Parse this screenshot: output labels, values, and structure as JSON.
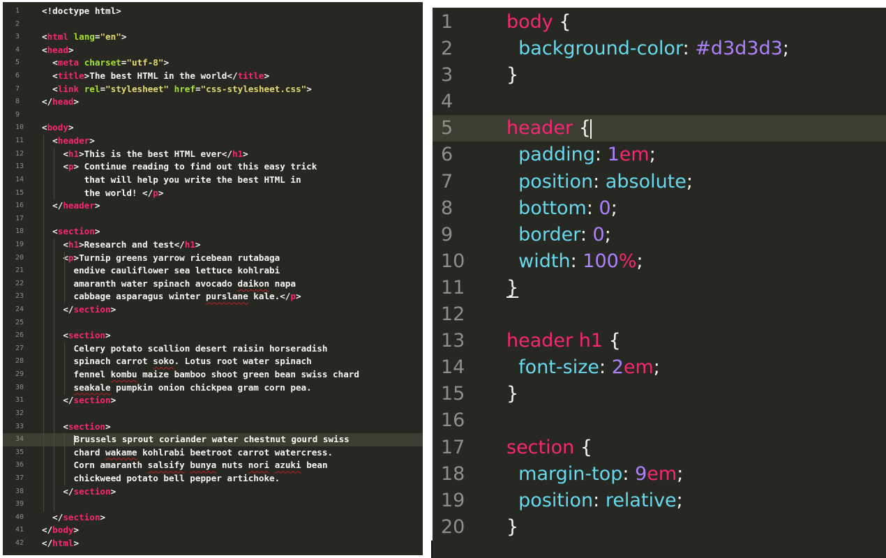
{
  "colors": {
    "editor_background": "#272822",
    "active_line": "#3e3d32",
    "gutter_text": "#8f908a",
    "tag": "#f92672",
    "attribute": "#a6e22e",
    "string": "#e6db74",
    "property": "#66d9ef",
    "number": "#ae81ff",
    "text": "#f8f8f2"
  },
  "html_editor": {
    "active_line_number": "34",
    "lines": [
      {
        "n": "1",
        "tokens": [
          {
            "t": "<!doctype html>",
            "c": "text"
          }
        ]
      },
      {
        "n": "2",
        "tokens": []
      },
      {
        "n": "3",
        "tokens": [
          {
            "t": "<",
            "c": "punct"
          },
          {
            "t": "html",
            "c": "tag"
          },
          {
            "t": " ",
            "c": "text"
          },
          {
            "t": "lang",
            "c": "attr"
          },
          {
            "t": "=",
            "c": "punct"
          },
          {
            "t": "\"en\"",
            "c": "str"
          },
          {
            "t": ">",
            "c": "punct"
          }
        ]
      },
      {
        "n": "4",
        "tokens": [
          {
            "t": "<",
            "c": "punct"
          },
          {
            "t": "head",
            "c": "tag"
          },
          {
            "t": ">",
            "c": "punct"
          }
        ]
      },
      {
        "n": "5",
        "tokens": [
          {
            "t": "  <",
            "c": "punct"
          },
          {
            "t": "meta",
            "c": "tag"
          },
          {
            "t": " ",
            "c": "text"
          },
          {
            "t": "charset",
            "c": "attr"
          },
          {
            "t": "=",
            "c": "punct"
          },
          {
            "t": "\"utf-8\"",
            "c": "str"
          },
          {
            "t": ">",
            "c": "punct"
          }
        ]
      },
      {
        "n": "6",
        "tokens": [
          {
            "t": "  <",
            "c": "punct"
          },
          {
            "t": "title",
            "c": "tag"
          },
          {
            "t": ">The best HTML in the world</",
            "c": "text"
          },
          {
            "t": "title",
            "c": "tag"
          },
          {
            "t": ">",
            "c": "punct"
          }
        ]
      },
      {
        "n": "7",
        "tokens": [
          {
            "t": "  <",
            "c": "punct"
          },
          {
            "t": "link",
            "c": "tag"
          },
          {
            "t": " ",
            "c": "text"
          },
          {
            "t": "rel",
            "c": "attr"
          },
          {
            "t": "=",
            "c": "punct"
          },
          {
            "t": "\"stylesheet\"",
            "c": "str"
          },
          {
            "t": " ",
            "c": "text"
          },
          {
            "t": "href",
            "c": "attr"
          },
          {
            "t": "=",
            "c": "punct"
          },
          {
            "t": "\"css-stylesheet.css\"",
            "c": "str"
          },
          {
            "t": ">",
            "c": "punct"
          }
        ]
      },
      {
        "n": "8",
        "tokens": [
          {
            "t": "</",
            "c": "punct"
          },
          {
            "t": "head",
            "c": "tag"
          },
          {
            "t": ">",
            "c": "punct"
          }
        ]
      },
      {
        "n": "9",
        "tokens": []
      },
      {
        "n": "10",
        "tokens": [
          {
            "t": "<",
            "c": "punct"
          },
          {
            "t": "body",
            "c": "tag"
          },
          {
            "t": ">",
            "c": "punct"
          }
        ]
      },
      {
        "n": "11",
        "tokens": [
          {
            "t": "  <",
            "c": "punct"
          },
          {
            "t": "header",
            "c": "tag"
          },
          {
            "t": ">",
            "c": "punct"
          }
        ]
      },
      {
        "n": "12",
        "tokens": [
          {
            "t": "    <",
            "c": "punct"
          },
          {
            "t": "h1",
            "c": "tag"
          },
          {
            "t": ">This is the best HTML ever</",
            "c": "text"
          },
          {
            "t": "h1",
            "c": "tag"
          },
          {
            "t": ">",
            "c": "punct"
          }
        ]
      },
      {
        "n": "13",
        "tokens": [
          {
            "t": "    <",
            "c": "punct"
          },
          {
            "t": "p",
            "c": "tag"
          },
          {
            "t": "> Continue reading to find out this easy trick",
            "c": "text"
          }
        ]
      },
      {
        "n": "14",
        "tokens": [
          {
            "t": "        that will help you write the best HTML in",
            "c": "text"
          }
        ]
      },
      {
        "n": "15",
        "tokens": [
          {
            "t": "        the world! </",
            "c": "text"
          },
          {
            "t": "p",
            "c": "tag"
          },
          {
            "t": ">",
            "c": "punct"
          }
        ]
      },
      {
        "n": "16",
        "tokens": [
          {
            "t": "  </",
            "c": "punct"
          },
          {
            "t": "header",
            "c": "tag"
          },
          {
            "t": ">",
            "c": "punct"
          }
        ]
      },
      {
        "n": "17",
        "tokens": []
      },
      {
        "n": "18",
        "tokens": [
          {
            "t": "  <",
            "c": "punct"
          },
          {
            "t": "section",
            "c": "tag"
          },
          {
            "t": ">",
            "c": "punct"
          }
        ]
      },
      {
        "n": "19",
        "tokens": [
          {
            "t": "    <",
            "c": "punct"
          },
          {
            "t": "h1",
            "c": "tag"
          },
          {
            "t": ">Research and test</",
            "c": "text"
          },
          {
            "t": "h1",
            "c": "tag"
          },
          {
            "t": ">",
            "c": "punct"
          }
        ]
      },
      {
        "n": "20",
        "tokens": [
          {
            "t": "    <",
            "c": "punct"
          },
          {
            "t": "p",
            "c": "tag"
          },
          {
            "t": ">Turnip greens yarrow ricebean rutabaga",
            "c": "text"
          }
        ]
      },
      {
        "n": "21",
        "tokens": [
          {
            "t": "      endive cauliflower sea lettuce kohlrabi",
            "c": "text"
          }
        ]
      },
      {
        "n": "22",
        "tokens": [
          {
            "t": "      amaranth water spinach avocado ",
            "c": "text"
          },
          {
            "t": "daikon",
            "c": "text",
            "u": true
          },
          {
            "t": " napa",
            "c": "text"
          }
        ]
      },
      {
        "n": "23",
        "tokens": [
          {
            "t": "      cabbage asparagus winter ",
            "c": "text"
          },
          {
            "t": "purslane",
            "c": "text",
            "u": true
          },
          {
            "t": " kale.</",
            "c": "text"
          },
          {
            "t": "p",
            "c": "tag"
          },
          {
            "t": ">",
            "c": "punct"
          }
        ]
      },
      {
        "n": "24",
        "tokens": [
          {
            "t": "    </",
            "c": "punct"
          },
          {
            "t": "section",
            "c": "tag"
          },
          {
            "t": ">",
            "c": "punct"
          }
        ]
      },
      {
        "n": "25",
        "tokens": []
      },
      {
        "n": "26",
        "tokens": [
          {
            "t": "    <",
            "c": "punct"
          },
          {
            "t": "section",
            "c": "tag"
          },
          {
            "t": ">",
            "c": "punct"
          }
        ]
      },
      {
        "n": "27",
        "tokens": [
          {
            "t": "      Celery potato scallion desert raisin horseradish",
            "c": "text"
          }
        ]
      },
      {
        "n": "28",
        "tokens": [
          {
            "t": "      spinach carrot ",
            "c": "text"
          },
          {
            "t": "soko",
            "c": "text",
            "u": true
          },
          {
            "t": ". Lotus root water spinach",
            "c": "text"
          }
        ]
      },
      {
        "n": "29",
        "tokens": [
          {
            "t": "      fennel ",
            "c": "text"
          },
          {
            "t": "kombu",
            "c": "text",
            "u": true
          },
          {
            "t": " maize bamboo shoot green bean swiss chard",
            "c": "text"
          }
        ]
      },
      {
        "n": "30",
        "tokens": [
          {
            "t": "      ",
            "c": "text"
          },
          {
            "t": "seakale",
            "c": "text",
            "u": true
          },
          {
            "t": " pumpkin onion chickpea gram corn pea.",
            "c": "text"
          }
        ]
      },
      {
        "n": "31",
        "tokens": [
          {
            "t": "    </",
            "c": "punct"
          },
          {
            "t": "section",
            "c": "tag"
          },
          {
            "t": ">",
            "c": "punct"
          }
        ]
      },
      {
        "n": "32",
        "tokens": []
      },
      {
        "n": "33",
        "tokens": [
          {
            "t": "    <",
            "c": "punct"
          },
          {
            "t": "section",
            "c": "tag"
          },
          {
            "t": ">",
            "c": "punct"
          }
        ]
      },
      {
        "n": "34",
        "tokens": [
          {
            "t": "      Brussels sprout coriander water chestnut gourd swiss",
            "c": "text"
          }
        ]
      },
      {
        "n": "35",
        "tokens": [
          {
            "t": "      chard ",
            "c": "text"
          },
          {
            "t": "wakame",
            "c": "text",
            "u": true
          },
          {
            "t": " kohlrabi beetroot carrot watercress.",
            "c": "text"
          }
        ]
      },
      {
        "n": "36",
        "tokens": [
          {
            "t": "      Corn amaranth ",
            "c": "text"
          },
          {
            "t": "salsify",
            "c": "text",
            "u": true
          },
          {
            "t": " ",
            "c": "text"
          },
          {
            "t": "bunya",
            "c": "text",
            "u": true
          },
          {
            "t": " nuts ",
            "c": "text"
          },
          {
            "t": "nori",
            "c": "text",
            "u": true
          },
          {
            "t": " ",
            "c": "text"
          },
          {
            "t": "azuki",
            "c": "text",
            "u": true
          },
          {
            "t": " bean",
            "c": "text"
          }
        ]
      },
      {
        "n": "37",
        "tokens": [
          {
            "t": "      chickweed potato bell pepper artichoke.",
            "c": "text"
          }
        ]
      },
      {
        "n": "38",
        "tokens": [
          {
            "t": "    </",
            "c": "punct"
          },
          {
            "t": "section",
            "c": "tag"
          },
          {
            "t": ">",
            "c": "punct"
          }
        ]
      },
      {
        "n": "39",
        "tokens": []
      },
      {
        "n": "40",
        "tokens": [
          {
            "t": "  </",
            "c": "punct"
          },
          {
            "t": "section",
            "c": "tag"
          },
          {
            "t": ">",
            "c": "punct"
          }
        ]
      },
      {
        "n": "41",
        "tokens": [
          {
            "t": "</",
            "c": "punct"
          },
          {
            "t": "body",
            "c": "tag"
          },
          {
            "t": ">",
            "c": "punct"
          }
        ]
      },
      {
        "n": "42",
        "tokens": [
          {
            "t": "</",
            "c": "punct"
          },
          {
            "t": "html",
            "c": "tag"
          },
          {
            "t": ">",
            "c": "punct"
          }
        ]
      }
    ]
  },
  "css_editor": {
    "active_line_number": "5",
    "lines": [
      {
        "n": "1",
        "tokens": [
          {
            "t": "body",
            "c": "sel"
          },
          {
            "t": " {",
            "c": "punct"
          }
        ]
      },
      {
        "n": "2",
        "tokens": [
          {
            "t": "  ",
            "c": "text"
          },
          {
            "t": "background-color",
            "c": "prop"
          },
          {
            "t": ": ",
            "c": "punct"
          },
          {
            "t": "#d3d3d3",
            "c": "num"
          },
          {
            "t": ";",
            "c": "punct"
          }
        ]
      },
      {
        "n": "3",
        "tokens": [
          {
            "t": "}",
            "c": "punct"
          }
        ]
      },
      {
        "n": "4",
        "tokens": []
      },
      {
        "n": "5",
        "tokens": [
          {
            "t": "header",
            "c": "sel"
          },
          {
            "t": " {",
            "c": "punct",
            "caret": true
          }
        ]
      },
      {
        "n": "6",
        "tokens": [
          {
            "t": "  ",
            "c": "text"
          },
          {
            "t": "padding",
            "c": "prop"
          },
          {
            "t": ": ",
            "c": "punct"
          },
          {
            "t": "1",
            "c": "num"
          },
          {
            "t": "em",
            "c": "unit"
          },
          {
            "t": ";",
            "c": "punct"
          }
        ]
      },
      {
        "n": "7",
        "tokens": [
          {
            "t": "  ",
            "c": "text"
          },
          {
            "t": "position",
            "c": "prop"
          },
          {
            "t": ": ",
            "c": "punct"
          },
          {
            "t": "absolute",
            "c": "kw"
          },
          {
            "t": ";",
            "c": "punct"
          }
        ]
      },
      {
        "n": "8",
        "tokens": [
          {
            "t": "  ",
            "c": "text"
          },
          {
            "t": "bottom",
            "c": "prop"
          },
          {
            "t": ": ",
            "c": "punct"
          },
          {
            "t": "0",
            "c": "num"
          },
          {
            "t": ";",
            "c": "punct"
          }
        ]
      },
      {
        "n": "9",
        "tokens": [
          {
            "t": "  ",
            "c": "text"
          },
          {
            "t": "border",
            "c": "prop"
          },
          {
            "t": ": ",
            "c": "punct"
          },
          {
            "t": "0",
            "c": "num"
          },
          {
            "t": ";",
            "c": "punct"
          }
        ]
      },
      {
        "n": "10",
        "tokens": [
          {
            "t": "  ",
            "c": "text"
          },
          {
            "t": "width",
            "c": "prop"
          },
          {
            "t": ": ",
            "c": "punct"
          },
          {
            "t": "100",
            "c": "num"
          },
          {
            "t": "%",
            "c": "unit"
          },
          {
            "t": ";",
            "c": "punct"
          }
        ]
      },
      {
        "n": "11",
        "tokens": [
          {
            "t": "}",
            "c": "punct",
            "ul": true
          }
        ]
      },
      {
        "n": "12",
        "tokens": []
      },
      {
        "n": "13",
        "tokens": [
          {
            "t": "header h1",
            "c": "sel"
          },
          {
            "t": " {",
            "c": "punct"
          }
        ]
      },
      {
        "n": "14",
        "tokens": [
          {
            "t": "  ",
            "c": "text"
          },
          {
            "t": "font-size",
            "c": "prop"
          },
          {
            "t": ": ",
            "c": "punct"
          },
          {
            "t": "2",
            "c": "num"
          },
          {
            "t": "em",
            "c": "unit"
          },
          {
            "t": ";",
            "c": "punct"
          }
        ]
      },
      {
        "n": "15",
        "tokens": [
          {
            "t": "}",
            "c": "punct"
          }
        ]
      },
      {
        "n": "16",
        "tokens": []
      },
      {
        "n": "17",
        "tokens": [
          {
            "t": "section",
            "c": "sel"
          },
          {
            "t": " {",
            "c": "punct"
          }
        ]
      },
      {
        "n": "18",
        "tokens": [
          {
            "t": "  ",
            "c": "text"
          },
          {
            "t": "margin-top",
            "c": "prop"
          },
          {
            "t": ": ",
            "c": "punct"
          },
          {
            "t": "9",
            "c": "num"
          },
          {
            "t": "em",
            "c": "unit"
          },
          {
            "t": ";",
            "c": "punct"
          }
        ]
      },
      {
        "n": "19",
        "tokens": [
          {
            "t": "  ",
            "c": "text"
          },
          {
            "t": "position",
            "c": "prop"
          },
          {
            "t": ": ",
            "c": "punct"
          },
          {
            "t": "relative",
            "c": "kw"
          },
          {
            "t": ";",
            "c": "punct"
          }
        ]
      },
      {
        "n": "20",
        "tokens": [
          {
            "t": "}",
            "c": "punct"
          }
        ]
      }
    ]
  }
}
